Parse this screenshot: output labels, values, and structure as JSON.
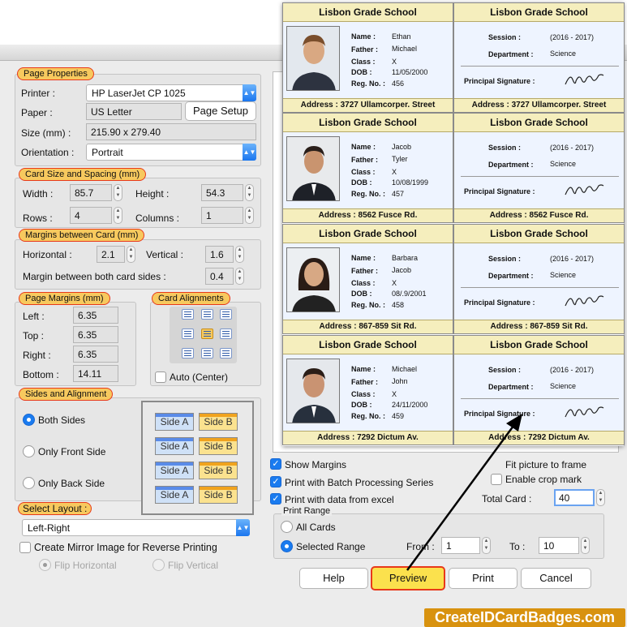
{
  "page_properties": {
    "caption": "Page Properties",
    "printer_label": "Printer :",
    "printer_value": "HP LaserJet CP 1025",
    "paper_label": "Paper :",
    "paper_value": "US Letter",
    "page_setup_button": "Page Setup",
    "size_label": "Size (mm) :",
    "size_value": "215.90 x 279.40",
    "orientation_label": "Orientation :",
    "orientation_value": "Portrait"
  },
  "card_size": {
    "caption": "Card Size and Spacing (mm)",
    "width_label": "Width :",
    "width_value": "85.7",
    "height_label": "Height :",
    "height_value": "54.3",
    "rows_label": "Rows :",
    "rows_value": "4",
    "columns_label": "Columns :",
    "columns_value": "1"
  },
  "margins_between": {
    "caption": "Margins between Card (mm)",
    "horizontal_label": "Horizontal :",
    "horizontal_value": "2.1",
    "vertical_label": "Vertical :",
    "vertical_value": "1.6",
    "both_sides_label": "Margin between both card sides :",
    "both_sides_value": "0.4"
  },
  "page_margins": {
    "caption": "Page Margins (mm)",
    "left_label": "Left :",
    "left_value": "6.35",
    "top_label": "Top :",
    "top_value": "6.35",
    "right_label": "Right :",
    "right_value": "6.35",
    "bottom_label": "Bottom :",
    "bottom_value": "14.11"
  },
  "card_alignments": {
    "caption": "Card Alignments",
    "auto_center_label": "Auto (Center)"
  },
  "sides": {
    "caption": "Sides and Alignment",
    "both_sides": "Both Sides",
    "only_front": "Only Front Side",
    "only_back": "Only Back Side",
    "side_a": "Side A",
    "side_b": "Side B"
  },
  "layout": {
    "caption": "Select Layout :",
    "value": "Left-Right",
    "mirror_label": "Create Mirror Image for Reverse Printing",
    "flip_horizontal": "Flip Horizontal",
    "flip_vertical": "Flip Vertical"
  },
  "options": {
    "show_margins": "Show Margins",
    "batch_processing": "Print with Batch Processing Series",
    "data_from_excel": "Print with data from excel",
    "fit_picture": "Fit picture to frame",
    "enable_crop": "Enable crop mark",
    "total_card_label": "Total Card :",
    "total_card_value": "40"
  },
  "print_range": {
    "caption": "Print Range",
    "all_cards": "All Cards",
    "selected_range": "Selected Range",
    "from_label": "From :",
    "from_value": "1",
    "to_label": "To :",
    "to_value": "10"
  },
  "buttons": {
    "help": "Help",
    "preview": "Preview",
    "print": "Print",
    "cancel": "Cancel"
  },
  "preview_cards": {
    "school": "Lisbon Grade School",
    "labels": {
      "name": "Name :",
      "father": "Father :",
      "class": "Class :",
      "dob": "DOB :",
      "reg": "Reg. No. :",
      "session": "Session :",
      "department": "Department :",
      "principal": "Principal Signature :",
      "address": "Address :"
    },
    "session_value": "(2016 - 2017)",
    "department_value": "Science",
    "students": [
      {
        "name": "Ethan",
        "father": "Michael",
        "class": "X",
        "dob": "11/05/2000",
        "reg": "456",
        "address": "3727 Ullamcorper. Street"
      },
      {
        "name": "Jacob",
        "father": "Tyler",
        "class": "X",
        "dob": "10/08/1999",
        "reg": "457",
        "address": "8562 Fusce Rd."
      },
      {
        "name": "Barbara",
        "father": "Jacob",
        "class": "X",
        "dob": "08/.9/2001",
        "reg": "458",
        "address": "867-859 Sit Rd."
      },
      {
        "name": "Michael",
        "father": "John",
        "class": "X",
        "dob": "24/11/2000",
        "reg": "459",
        "address": "7292 Dictum Av."
      }
    ]
  },
  "brand": "CreateIDCardBadges.com"
}
